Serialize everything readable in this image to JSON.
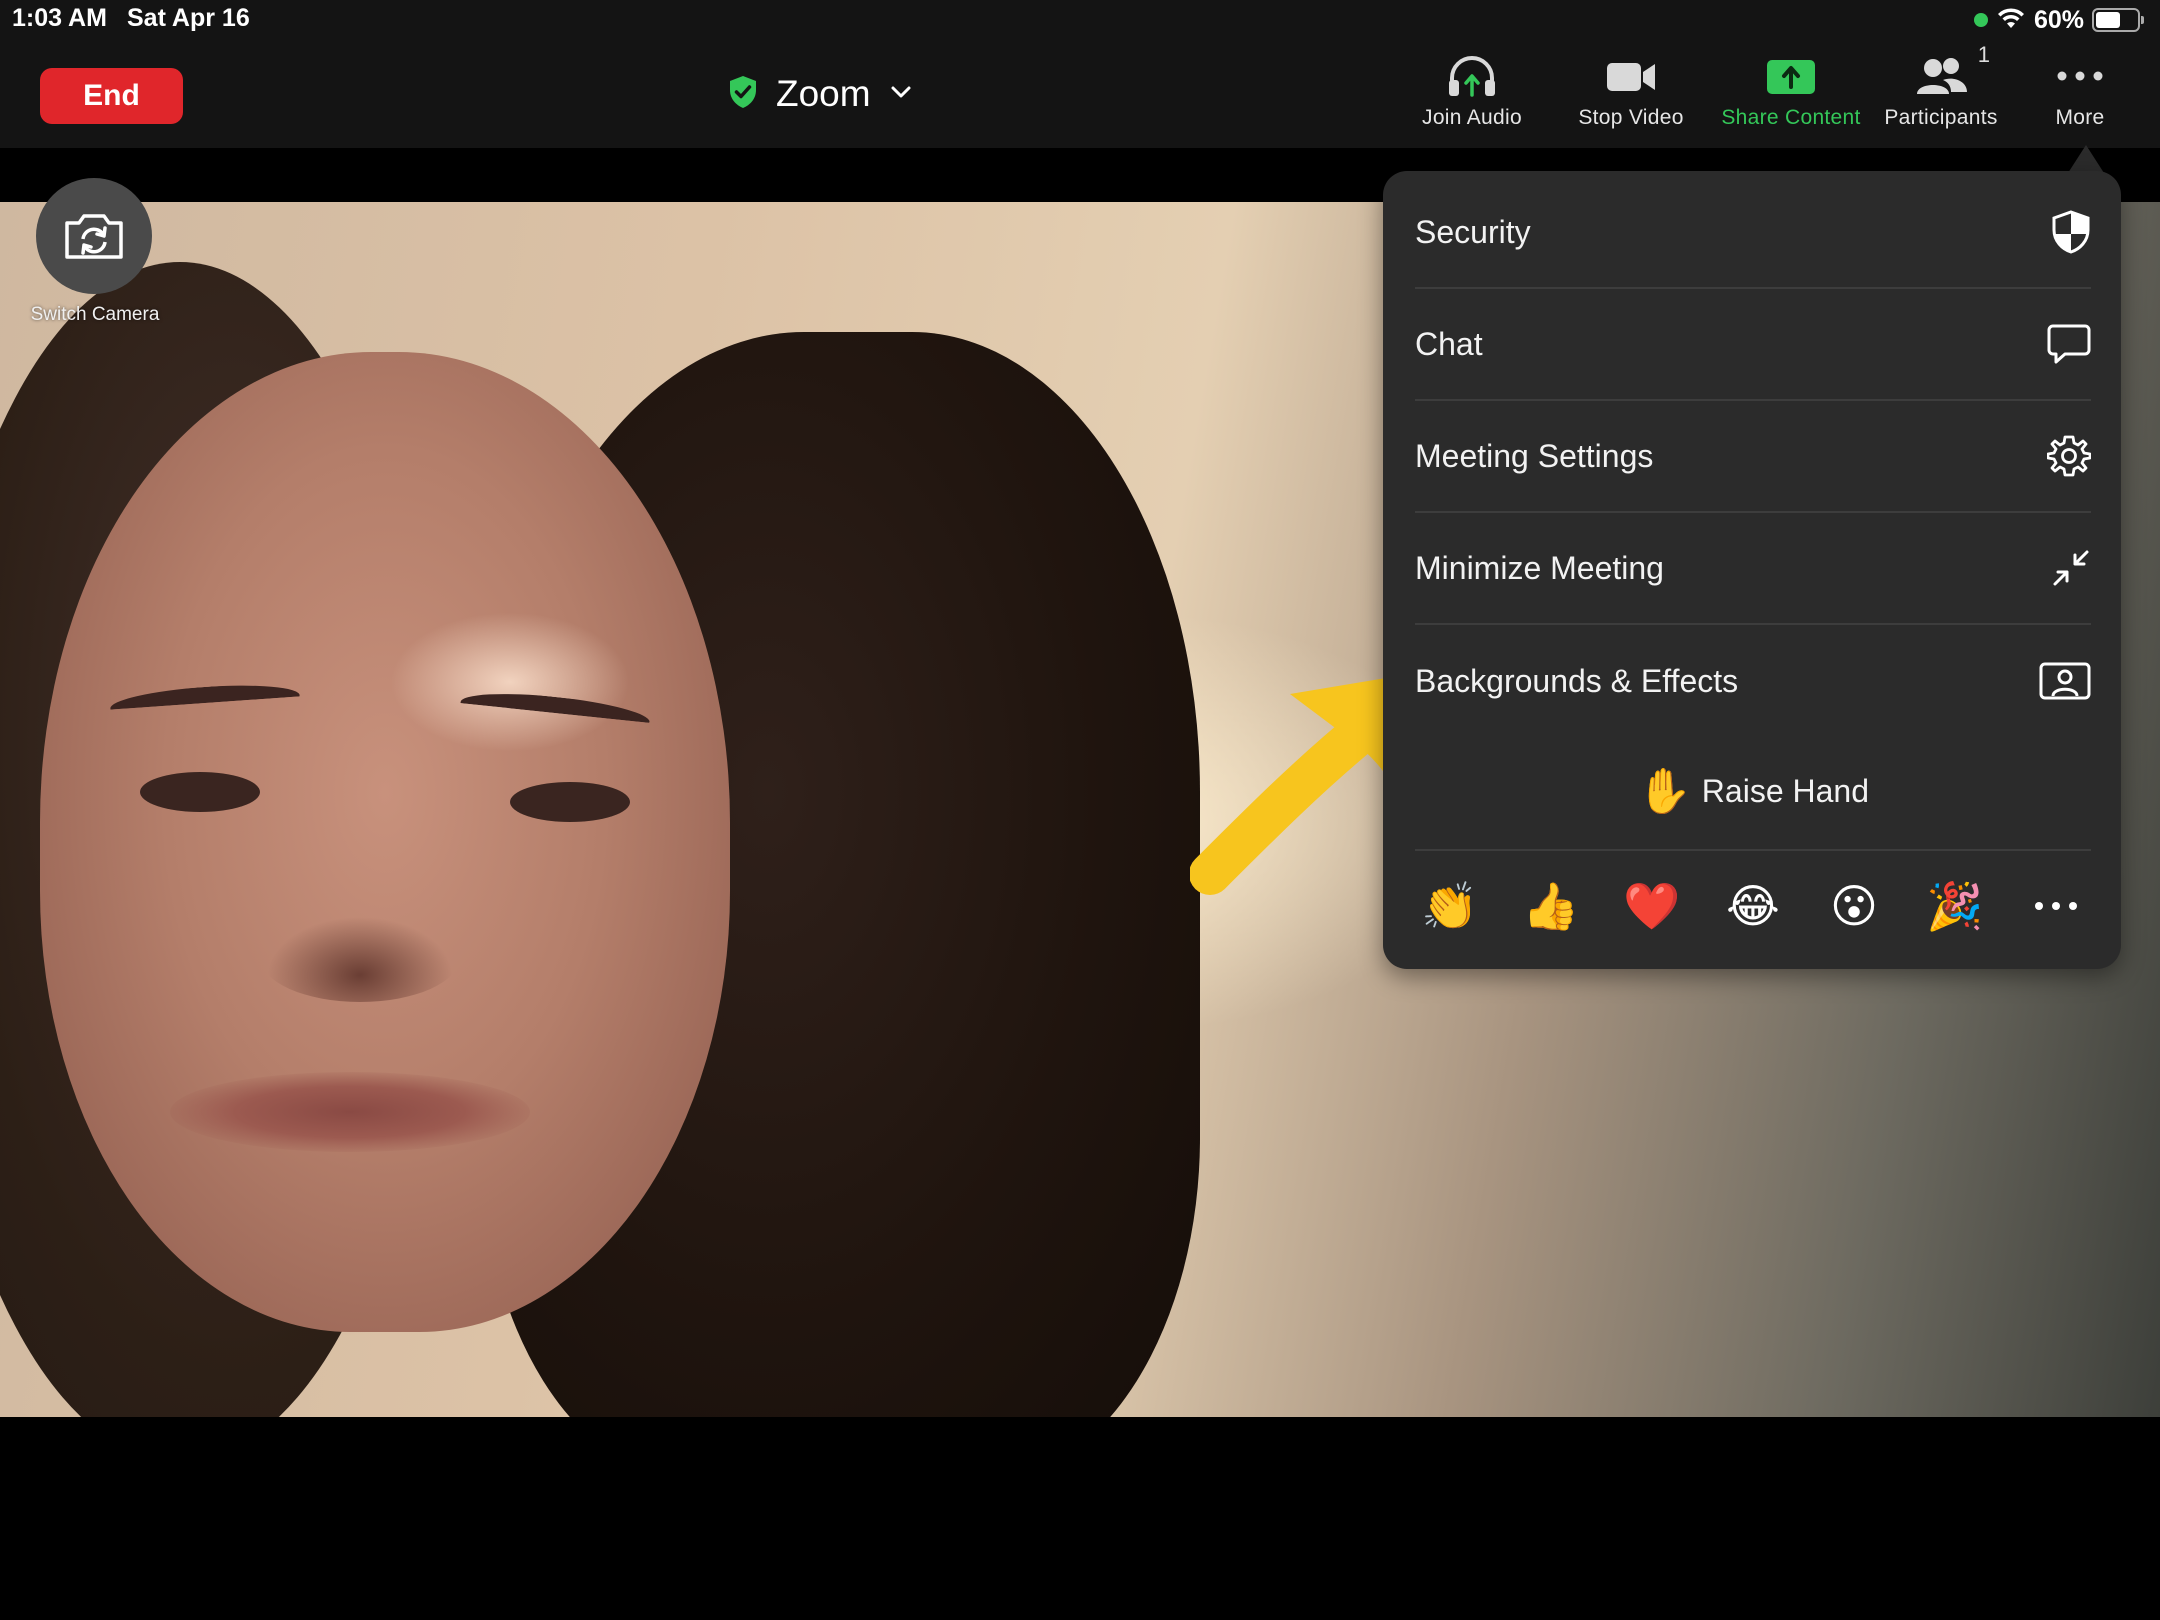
{
  "status_bar": {
    "time": "1:03 AM",
    "date": "Sat Apr 16",
    "battery": "60%",
    "battery_level": 0.6
  },
  "toolbar": {
    "end_label": "End",
    "meeting_title": "Zoom",
    "join_audio": "Join Audio",
    "stop_video": "Stop Video",
    "share_content": "Share Content",
    "participants": "Participants",
    "participant_count": "1",
    "more": "More"
  },
  "video": {
    "switch_camera_label": "Switch Camera"
  },
  "more_menu": {
    "items": [
      {
        "label": "Security",
        "icon": "shield-icon"
      },
      {
        "label": "Chat",
        "icon": "chat-bubble-icon"
      },
      {
        "label": "Meeting Settings",
        "icon": "gear-icon"
      },
      {
        "label": "Minimize Meeting",
        "icon": "minimize-icon"
      },
      {
        "label": "Backgrounds & Effects",
        "icon": "portrait-icon"
      }
    ],
    "raise_hand": {
      "emoji": "✋",
      "label": "Raise Hand"
    },
    "reactions": [
      "👏",
      "👍",
      "❤️",
      "😂",
      "😮",
      "🎉"
    ]
  },
  "colors": {
    "end_button": "#e0262b",
    "share_green": "#34c759",
    "menu_bg": "#2b2b2b",
    "annotation_arrow": "#f7c51e"
  }
}
